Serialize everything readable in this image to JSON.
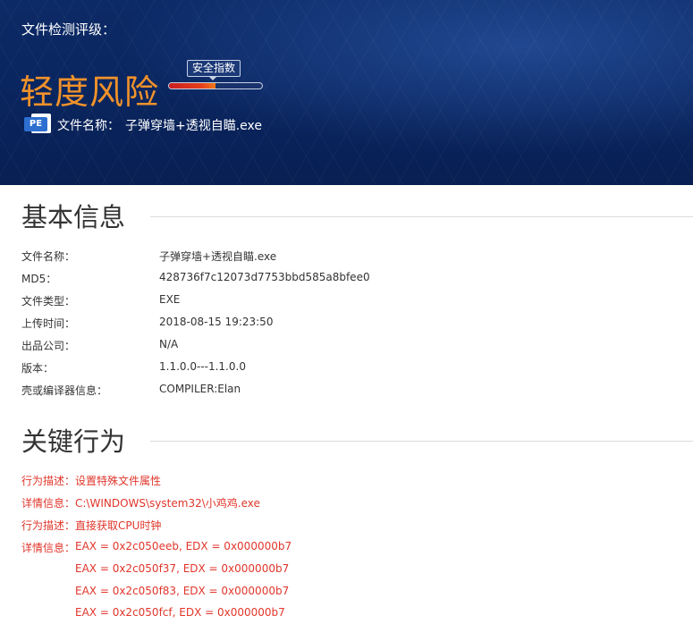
{
  "header": {
    "eval_label": "文件检测评级：",
    "risk_level": "轻度风险",
    "safety_index_label": "安全指数",
    "safety_index_fill": 0.5,
    "file_icon_text": "PE",
    "file_name_label": "文件名称：",
    "file_name_value": "子弹穿墙+透视自瞄.exe"
  },
  "basic_info": {
    "title": "基本信息",
    "rows": [
      {
        "label": "文件名称：",
        "value": "子弹穿墙+透视自瞄.exe"
      },
      {
        "label": "MD5：",
        "value": "428736f7c12073d7753bbd585a8bfee0"
      },
      {
        "label": "文件类型：",
        "value": "EXE"
      },
      {
        "label": "上传时间：",
        "value": "2018-08-15 19:23:50"
      },
      {
        "label": "出品公司：",
        "value": "N/A"
      },
      {
        "label": "版本：",
        "value": "1.1.0.0---1.1.0.0"
      },
      {
        "label": "壳或编译器信息：",
        "value": "COMPILER:Elan"
      }
    ]
  },
  "key_behavior": {
    "title": "关键行为",
    "rows": [
      {
        "label": "行为描述：",
        "value": "设置特殊文件属性"
      },
      {
        "label": "详情信息：",
        "value": "C:\\WINDOWS\\system32\\小鸡鸡.exe"
      },
      {
        "label": "行为描述：",
        "value": "直接获取CPU时钟"
      },
      {
        "label": "详情信息：",
        "value": "EAX = 0x2c050eeb, EDX = 0x000000b7"
      },
      {
        "label": "",
        "value": "EAX = 0x2c050f37, EDX = 0x000000b7"
      },
      {
        "label": "",
        "value": "EAX = 0x2c050f83, EDX = 0x000000b7"
      },
      {
        "label": "",
        "value": "EAX = 0x2c050fcf, EDX = 0x000000b7"
      }
    ]
  },
  "colors": {
    "banner": "#0a2660",
    "risk_orange": "#f2922a",
    "behavior_red": "#e0362b"
  }
}
